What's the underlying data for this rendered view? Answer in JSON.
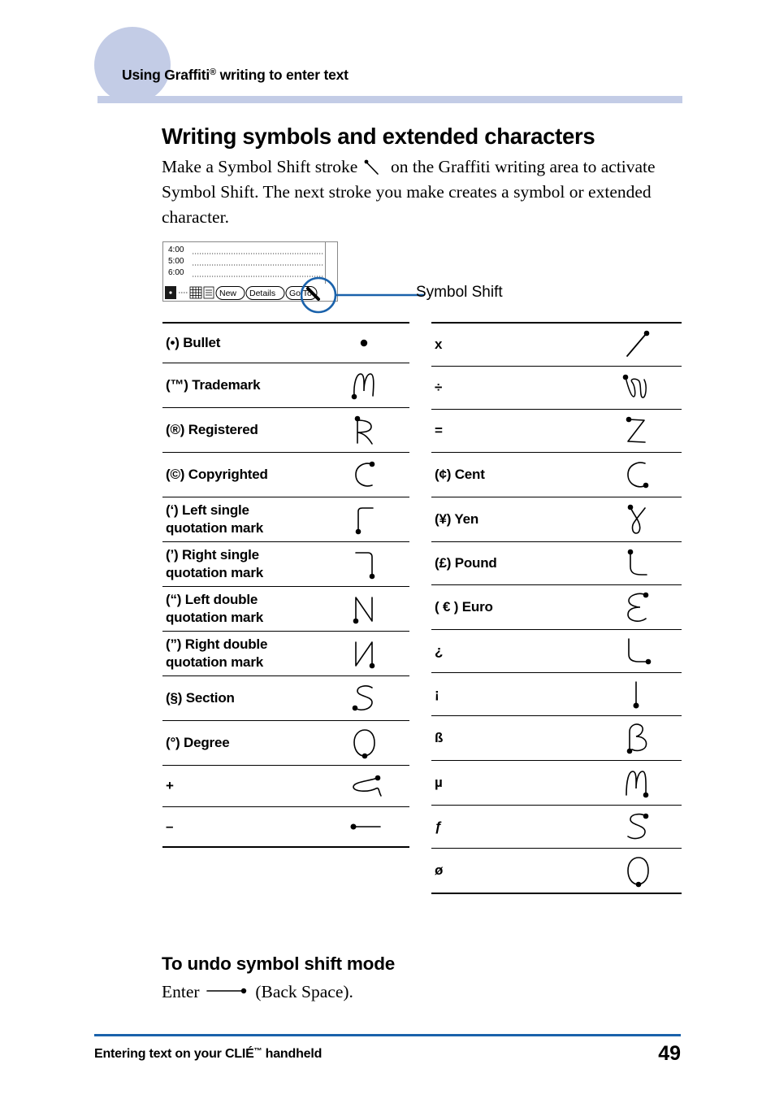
{
  "header": {
    "title_main": "Using Graffiti",
    "title_sup": "®",
    "title_rest": " writing to enter text",
    "accent_color": "#c3cce6"
  },
  "section": {
    "heading": "Writing symbols and extended characters",
    "intro_part1": "Make a Symbol Shift stroke ",
    "intro_part2": " on the Graffiti writing area to activate Symbol Shift. The next stroke you make creates a symbol or extended character."
  },
  "illustration": {
    "times": [
      "4:00",
      "5:00",
      "6:00"
    ],
    "buttons": [
      "New",
      "Details",
      "Go To"
    ],
    "callout_label": "Symbol Shift",
    "callout_color": "#1a62ab"
  },
  "table_left": {
    "rows": [
      {
        "label": "(•) Bullet",
        "label2": "",
        "stroke": "bullet"
      },
      {
        "label": "(™) Trademark",
        "label2": "",
        "stroke": "trademark"
      },
      {
        "label": "(®) Registered",
        "label2": "",
        "stroke": "registered"
      },
      {
        "label": "(©) Copyrighted",
        "label2": "",
        "stroke": "copyright"
      },
      {
        "label": "(‘) Left single",
        "label2": "quotation mark",
        "stroke": "left-single-quote"
      },
      {
        "label": "(’) Right single",
        "label2": "quotation mark",
        "stroke": "right-single-quote"
      },
      {
        "label": "(“) Left double",
        "label2": "quotation mark",
        "stroke": "left-double-quote"
      },
      {
        "label": "(”) Right double",
        "label2": "quotation mark",
        "stroke": "right-double-quote"
      },
      {
        "label": "(§) Section",
        "label2": "",
        "stroke": "section"
      },
      {
        "label": "(°) Degree",
        "label2": "",
        "stroke": "degree"
      },
      {
        "label": "+",
        "label2": "",
        "stroke": "plus"
      },
      {
        "label": "–",
        "label2": "",
        "stroke": "minus"
      }
    ]
  },
  "table_right": {
    "rows": [
      {
        "label": "x",
        "label2": "",
        "stroke": "multiply"
      },
      {
        "label": "÷",
        "label2": "",
        "stroke": "divide"
      },
      {
        "label": "=",
        "label2": "",
        "stroke": "equals"
      },
      {
        "label": "(¢) Cent",
        "label2": "",
        "stroke": "cent"
      },
      {
        "label": "(¥) Yen",
        "label2": "",
        "stroke": "yen"
      },
      {
        "label": "(£) Pound",
        "label2": "",
        "stroke": "pound"
      },
      {
        "label": "( € ) Euro",
        "label2": "",
        "stroke": "euro"
      },
      {
        "label": "¿",
        "label2": "",
        "stroke": "inverted-question"
      },
      {
        "label": "¡",
        "label2": "",
        "stroke": "inverted-exclamation"
      },
      {
        "label": "ß",
        "label2": "",
        "stroke": "eszett"
      },
      {
        "label": "µ",
        "label2": "",
        "stroke": "micro"
      },
      {
        "label": "ƒ",
        "label2": "",
        "stroke": "florin"
      },
      {
        "label": "ø",
        "label2": "",
        "stroke": "oslash"
      }
    ]
  },
  "undo": {
    "heading": "To undo symbol shift mode",
    "text_before": "Enter ",
    "text_after": " (Back Space)."
  },
  "footer": {
    "text_main": "Entering text on your CLIÉ",
    "text_sup": "™",
    "text_rest": " handheld",
    "page_number": "49",
    "rule_color": "#1a62ab"
  }
}
